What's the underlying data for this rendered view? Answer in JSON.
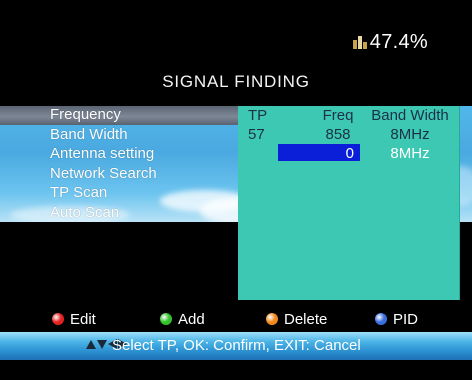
{
  "status": {
    "icon": "hdd-usage-icon",
    "storage_text": "47.4%"
  },
  "title": "SIGNAL FINDING",
  "menu": {
    "items": [
      {
        "label": "Frequency",
        "selected": true
      },
      {
        "label": "Band Width"
      },
      {
        "label": "Antenna setting"
      },
      {
        "label": "Network Search"
      },
      {
        "label": "TP Scan"
      },
      {
        "label": "Auto Scan"
      }
    ]
  },
  "tp_table": {
    "headers": {
      "tp": "TP",
      "freq": "Freq",
      "bandwidth": "Band Width"
    },
    "row1": {
      "tp": "57",
      "freq": "858",
      "bandwidth": "8MHz"
    },
    "row2": {
      "tp": "",
      "freq": "0",
      "bandwidth": "8MHz"
    }
  },
  "legend": [
    {
      "label": "Edit",
      "color": "#e52222"
    },
    {
      "label": "Add",
      "color": "#32c22a"
    },
    {
      "label": "Delete",
      "color": "#f08a1f"
    },
    {
      "label": "PID",
      "color": "#3a6fe0"
    }
  ],
  "help": {
    "text": "Select TP, OK: Confirm, EXIT: Cancel"
  },
  "colors": {
    "panel": "#3dc8b4",
    "edit_field": "#0b1fd8",
    "sky": "#51b7ea"
  }
}
